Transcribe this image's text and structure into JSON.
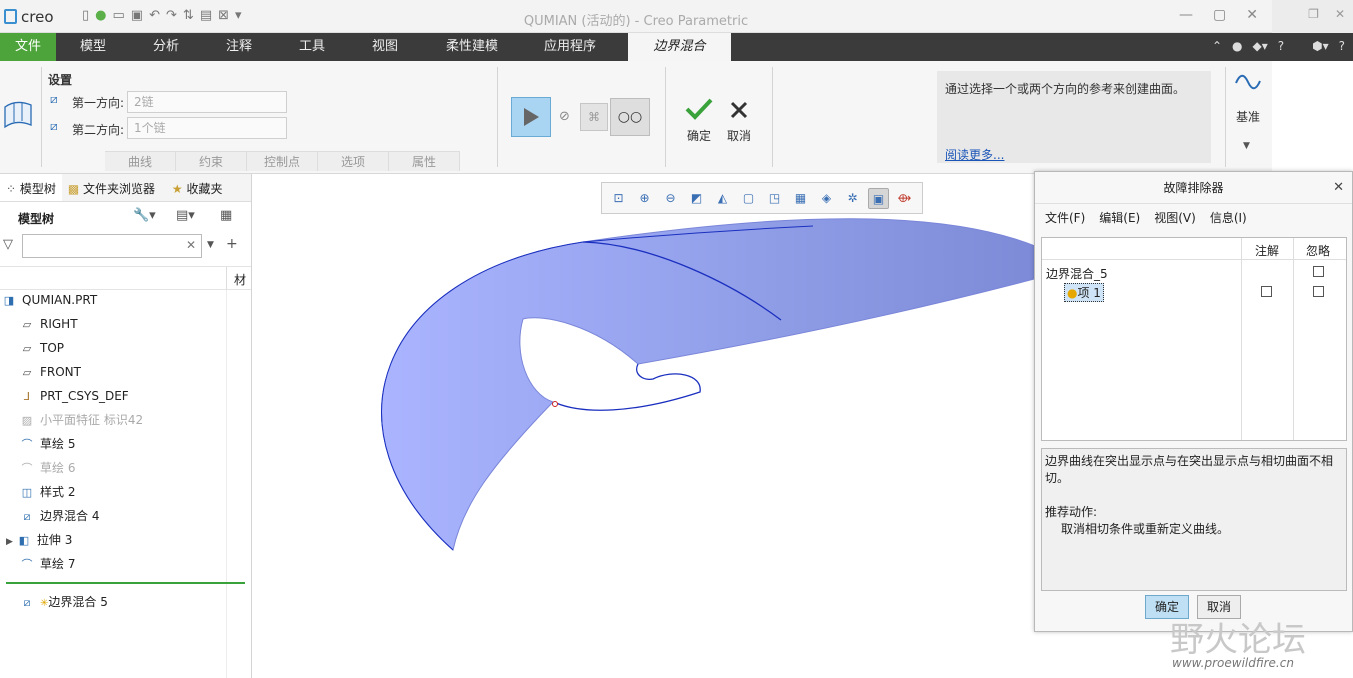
{
  "window": {
    "app_name": "creo",
    "title": "QUMIAN (活动的) - Creo Parametric"
  },
  "colors": {
    "file_tab": "#4da43a",
    "tabbar": "#3b3b3b",
    "surface": "#8f9ee8",
    "edge": "#1a2fbf",
    "dialog_ok": "#bfe0f4"
  },
  "tabs": [
    {
      "label": "文件"
    },
    {
      "label": "模型"
    },
    {
      "label": "分析"
    },
    {
      "label": "注释"
    },
    {
      "label": "工具"
    },
    {
      "label": "视图"
    },
    {
      "label": "柔性建模"
    },
    {
      "label": "应用程序"
    },
    {
      "label": "边界混合"
    }
  ],
  "ribbon": {
    "settings_label": "设置",
    "first_dir_label": "第一方向:",
    "first_dir_value": "2链",
    "second_dir_label": "第二方向:",
    "second_dir_value": "1个链",
    "subtabs": [
      "曲线",
      "约束",
      "控制点",
      "选项",
      "属性"
    ],
    "confirm_label": "确定",
    "cancel_label": "取消",
    "help_text": "通过选择一个或两个方向的参考来创建曲面。",
    "help_link": "阅读更多...",
    "datum_label": "基准"
  },
  "model_tree": {
    "tabs": [
      "模型树",
      "文件夹浏览器",
      "收藏夹"
    ],
    "header": "模型树",
    "column_label": "材",
    "items": [
      {
        "label": "QUMIAN.PRT",
        "icon": "part-icon"
      },
      {
        "label": "RIGHT",
        "icon": "datum-plane-icon"
      },
      {
        "label": "TOP",
        "icon": "datum-plane-icon"
      },
      {
        "label": "FRONT",
        "icon": "datum-plane-icon"
      },
      {
        "label": "PRT_CSYS_DEF",
        "icon": "csys-icon"
      },
      {
        "label": "小平面特征 标识42",
        "icon": "facet-icon"
      },
      {
        "label": "草绘 5",
        "icon": "sketch-icon"
      },
      {
        "label": "草绘 6",
        "icon": "sketch-icon"
      },
      {
        "label": "样式 2",
        "icon": "style-icon"
      },
      {
        "label": "边界混合 4",
        "icon": "boundary-blend-icon"
      },
      {
        "label": "拉伸 3",
        "icon": "extrude-icon"
      },
      {
        "label": "草绘 7",
        "icon": "sketch-icon"
      }
    ],
    "insert_item": "边界混合 5"
  },
  "dialog": {
    "title": "故障排除器",
    "menu": [
      "文件(F)",
      "编辑(E)",
      "视图(V)",
      "信息(I)"
    ],
    "col_note": "注解",
    "col_ignore": "忽略",
    "row_feature": "边界混合_5",
    "row_item": "项 1",
    "message": "边界曲线在突出显示点与在突出显示点与相切曲面不相切。",
    "recommend_label": "推荐动作:",
    "recommend_text": "取消相切条件或重新定义曲线。",
    "ok_label": "确定",
    "cancel_label": "取消"
  },
  "watermark": {
    "text": "野火论坛",
    "url": "www.proewildfire.cn"
  }
}
